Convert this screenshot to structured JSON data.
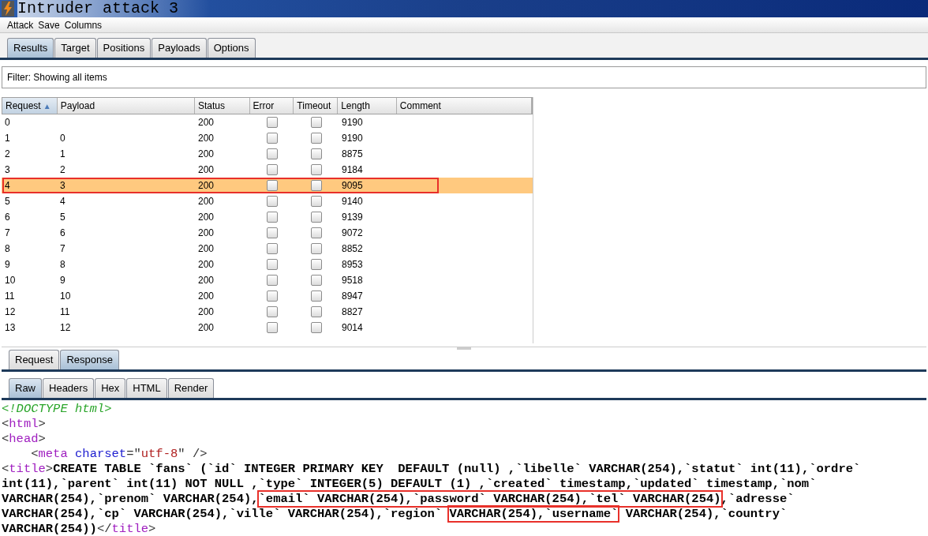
{
  "window": {
    "title": "Intruder attack 3"
  },
  "menu": [
    "Attack",
    "Save",
    "Columns"
  ],
  "tabs": [
    {
      "label": "Results",
      "selected": true
    },
    {
      "label": "Target",
      "selected": false
    },
    {
      "label": "Positions",
      "selected": false
    },
    {
      "label": "Payloads",
      "selected": false
    },
    {
      "label": "Options",
      "selected": false
    }
  ],
  "filter": "Filter:  Showing all items",
  "table": {
    "columns": [
      {
        "label": "Request",
        "sort": "▲"
      },
      {
        "label": "Payload"
      },
      {
        "label": "Status"
      },
      {
        "label": "Error"
      },
      {
        "label": "Timeout"
      },
      {
        "label": "Length"
      },
      {
        "label": "Comment"
      }
    ],
    "rows": [
      {
        "request": "0",
        "payload": "",
        "status": "200",
        "error": false,
        "timeout": false,
        "length": "9190",
        "selected": false,
        "boxed": false
      },
      {
        "request": "1",
        "payload": "0",
        "status": "200",
        "error": false,
        "timeout": false,
        "length": "9190",
        "selected": false,
        "boxed": false
      },
      {
        "request": "2",
        "payload": "1",
        "status": "200",
        "error": false,
        "timeout": false,
        "length": "8875",
        "selected": false,
        "boxed": false
      },
      {
        "request": "3",
        "payload": "2",
        "status": "200",
        "error": false,
        "timeout": false,
        "length": "9184",
        "selected": false,
        "boxed": false
      },
      {
        "request": "4",
        "payload": "3",
        "status": "200",
        "error": false,
        "timeout": false,
        "length": "9095",
        "selected": true,
        "boxed": true
      },
      {
        "request": "5",
        "payload": "4",
        "status": "200",
        "error": false,
        "timeout": false,
        "length": "9140",
        "selected": false,
        "boxed": false
      },
      {
        "request": "6",
        "payload": "5",
        "status": "200",
        "error": false,
        "timeout": false,
        "length": "9139",
        "selected": false,
        "boxed": false
      },
      {
        "request": "7",
        "payload": "6",
        "status": "200",
        "error": false,
        "timeout": false,
        "length": "9072",
        "selected": false,
        "boxed": false
      },
      {
        "request": "8",
        "payload": "7",
        "status": "200",
        "error": false,
        "timeout": false,
        "length": "8852",
        "selected": false,
        "boxed": false
      },
      {
        "request": "9",
        "payload": "8",
        "status": "200",
        "error": false,
        "timeout": false,
        "length": "8953",
        "selected": false,
        "boxed": false
      },
      {
        "request": "10",
        "payload": "9",
        "status": "200",
        "error": false,
        "timeout": false,
        "length": "9518",
        "selected": false,
        "boxed": false
      },
      {
        "request": "11",
        "payload": "10",
        "status": "200",
        "error": false,
        "timeout": false,
        "length": "8947",
        "selected": false,
        "boxed": false
      },
      {
        "request": "12",
        "payload": "11",
        "status": "200",
        "error": false,
        "timeout": false,
        "length": "8827",
        "selected": false,
        "boxed": false
      },
      {
        "request": "13",
        "payload": "12",
        "status": "200",
        "error": false,
        "timeout": false,
        "length": "9014",
        "selected": false,
        "boxed": false
      }
    ]
  },
  "message_tabs": [
    {
      "label": "Request",
      "selected": false
    },
    {
      "label": "Response",
      "selected": true
    }
  ],
  "view_tabs": [
    {
      "label": "Raw",
      "selected": true
    },
    {
      "label": "Headers",
      "selected": false
    },
    {
      "label": "Hex",
      "selected": false
    },
    {
      "label": "HTML",
      "selected": false
    },
    {
      "label": "Render",
      "selected": false
    }
  ],
  "code_lines": [
    [
      {
        "kind": "doctype",
        "text": "<!DOCTYPE html>"
      }
    ],
    [
      {
        "kind": "punct",
        "text": "<"
      },
      {
        "kind": "tag",
        "text": "html"
      },
      {
        "kind": "punct",
        "text": ">"
      }
    ],
    [
      {
        "kind": "punct",
        "text": "<"
      },
      {
        "kind": "tag",
        "text": "head"
      },
      {
        "kind": "punct",
        "text": ">"
      }
    ],
    [
      {
        "kind": "punct",
        "text": "    <"
      },
      {
        "kind": "tag",
        "text": "meta"
      },
      {
        "kind": "attr",
        "text": " charset"
      },
      {
        "kind": "punct",
        "text": "=\""
      },
      {
        "kind": "value",
        "text": "utf-8"
      },
      {
        "kind": "punct",
        "text": "\" />"
      }
    ],
    [
      {
        "kind": "punct",
        "text": "<"
      },
      {
        "kind": "tag",
        "text": "title"
      },
      {
        "kind": "punct",
        "text": ">"
      },
      {
        "kind": "text",
        "text": "CREATE TABLE `fans` (`id` INTEGER PRIMARY KEY  DEFAULT (null) ,`libelle` VARCHAR(254),`statut` int(11),`ordre`"
      }
    ],
    [
      {
        "kind": "text",
        "text": "int(11),`parent` int(11) NOT NULL ,`type` INTEGER(5) DEFAULT (1) ,`created` timestamp,`updated` timestamp,`nom`"
      }
    ],
    [
      {
        "kind": "text",
        "text": "VARCHAR(254),`prenom` VARCHAR(254),"
      },
      {
        "kind": "text",
        "text": "`email` VARCHAR(254),`password` VARCHAR(254),`tel` VARCHAR(254)",
        "boxed": true
      },
      {
        "kind": "text",
        "text": ",`adresse`"
      }
    ],
    [
      {
        "kind": "text",
        "text": "VARCHAR(254),`cp` VARCHAR(254),`ville` VARCHAR(254),`region` "
      },
      {
        "kind": "text",
        "text": "VARCHAR(254),`username`",
        "boxed": true
      },
      {
        "kind": "text",
        "text": " VARCHAR(254),`country`"
      }
    ],
    [
      {
        "kind": "text",
        "text": "VARCHAR(254))"
      },
      {
        "kind": "punct",
        "text": "</"
      },
      {
        "kind": "tag",
        "text": "title"
      },
      {
        "kind": "punct",
        "text": ">"
      }
    ]
  ]
}
